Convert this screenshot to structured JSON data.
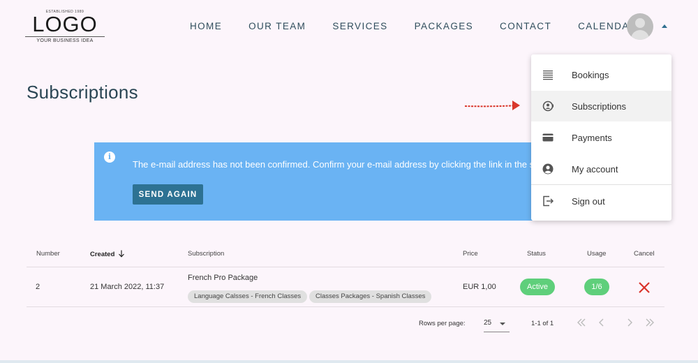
{
  "logo": {
    "established": "ESTABLISHED 1989",
    "word": "LOGO",
    "tagline": "YOUR BUSINESS IDEA"
  },
  "nav": {
    "items": [
      {
        "label": "HOME"
      },
      {
        "label": "OUR TEAM"
      },
      {
        "label": "SERVICES"
      },
      {
        "label": "PACKAGES"
      },
      {
        "label": "CONTACT"
      },
      {
        "label": "CALENDAR"
      }
    ]
  },
  "page": {
    "title": "Subscriptions"
  },
  "alert": {
    "message": "The e-mail address has not been confirmed. Confirm your e-mail address by clicking the link in the se",
    "button_label": "SEND AGAIN"
  },
  "menu": {
    "items": [
      {
        "label": "Bookings",
        "icon": "list-icon"
      },
      {
        "label": "Subscriptions",
        "icon": "subscription-icon",
        "active": true
      },
      {
        "label": "Payments",
        "icon": "credit-card-icon"
      },
      {
        "label": "My account",
        "icon": "account-circle-icon"
      },
      {
        "label": "Sign out",
        "icon": "sign-out-icon"
      }
    ]
  },
  "table": {
    "headers": {
      "number": "Number",
      "created": "Created",
      "subscription": "Subscription",
      "price": "Price",
      "status": "Status",
      "usage": "Usage",
      "cancel": "Cancel"
    },
    "rows": [
      {
        "number": "2",
        "created": "21 March 2022, 11:37",
        "subscription": "French Pro Package",
        "tags": [
          "Language Calsses - French Classes",
          "Classes Packages - Spanish Classes"
        ],
        "price": "EUR 1,00",
        "status": "Active",
        "usage": "1/6"
      }
    ]
  },
  "pagination": {
    "rows_per_page_label": "Rows per page:",
    "rows_per_page_value": "25",
    "range": "1-1 of 1"
  },
  "colors": {
    "accent": "#2d7293",
    "alert_bg": "#6ab3f3",
    "status_active": "#5fcf7b",
    "cancel": "#d9332b",
    "annotation_arrow": "#d9382c"
  }
}
